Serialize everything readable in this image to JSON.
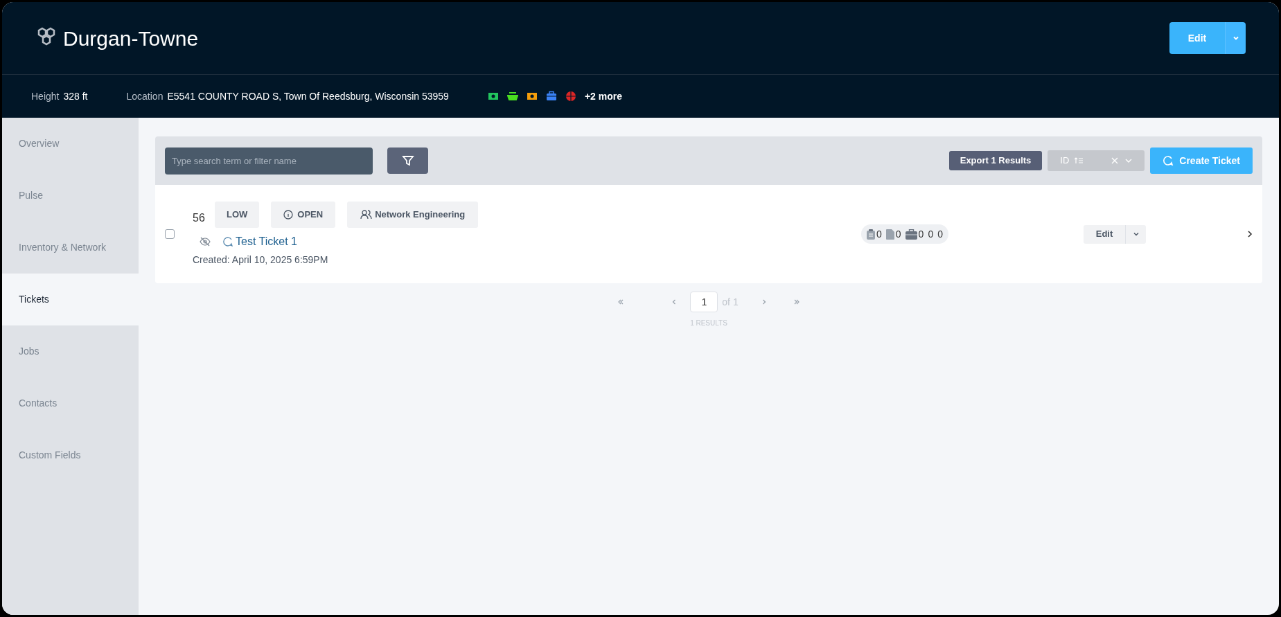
{
  "header": {
    "title": "Durgan-Towne",
    "edit_button": "Edit"
  },
  "info_bar": {
    "fields": [
      {
        "label": "Height",
        "value": "328 ft"
      },
      {
        "label": "Location",
        "value": "E5541 COUNTY ROAD S, Town Of Reedsburg, Wisconsin 53959"
      }
    ],
    "tags": [
      {
        "kind": "money",
        "color": "#22c55e"
      },
      {
        "kind": "stack",
        "color": "#4ade20"
      },
      {
        "kind": "money",
        "color": "#f59e0b"
      },
      {
        "kind": "briefcase",
        "color": "#3b82f6"
      },
      {
        "kind": "globe",
        "color": "#dc2626"
      }
    ],
    "more": "+2 more"
  },
  "sidebar": {
    "items": [
      {
        "label": "Overview",
        "selected": false
      },
      {
        "label": "Pulse",
        "selected": false
      },
      {
        "label": "Inventory & Network",
        "selected": false
      },
      {
        "label": "Tickets",
        "selected": true
      },
      {
        "label": "Jobs",
        "selected": false
      },
      {
        "label": "Contacts",
        "selected": false
      },
      {
        "label": "Custom Fields",
        "selected": false
      }
    ]
  },
  "toolbar": {
    "search": {
      "placeholder": "Type search term or filter name"
    },
    "export_button": "Export 1 Results",
    "sort": {
      "value": "ID"
    },
    "create_button": "Create Ticket"
  },
  "tickets": [
    {
      "checked": false,
      "id": "56",
      "priority": "LOW",
      "status": "OPEN",
      "team": "Network Engineering",
      "title": "Test Ticket 1",
      "created": "Created: April 10, 2025 6:59PM",
      "counts": [
        {
          "kind": "clipboard",
          "value": "0"
        },
        {
          "kind": "file",
          "value": "0"
        },
        {
          "kind": "briefcase",
          "value": "0"
        },
        {
          "kind": "plain",
          "value": "0"
        },
        {
          "kind": "plain",
          "value": "0"
        }
      ],
      "edit_button": "Edit"
    }
  ],
  "pagination": {
    "page": "1",
    "of": "of 1",
    "results": "1 RESULTS"
  }
}
